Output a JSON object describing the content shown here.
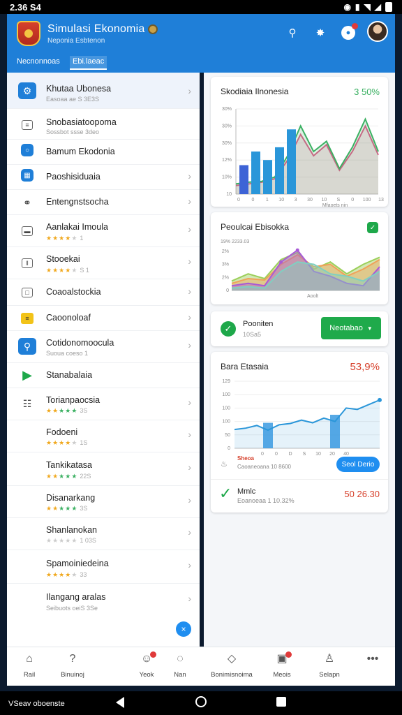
{
  "status_bar": {
    "time": "2.36  S4"
  },
  "app": {
    "title": "Simulasi Ekonomia",
    "subtitle": "Neponia Esbtenon",
    "tabs": [
      {
        "label": "Necnonnoas",
        "active": false
      },
      {
        "label": "Ebi.laeac",
        "active": true
      }
    ]
  },
  "list": [
    {
      "label": "Khutaa Ubonesa",
      "sub": "Easoaa ae S 3E3S",
      "icon": "settings-icon",
      "selected": true,
      "chevron": true
    },
    {
      "label": "Snobasiatoopoma",
      "sub": "Sossbot ssse 3deo",
      "icon": "document-icon",
      "chevron": false
    },
    {
      "label": "Bamum Ekodonia",
      "icon": "info-icon",
      "chevron": false
    },
    {
      "label": "Paoshisiduaia",
      "icon": "calendar-icon",
      "chevron": true
    },
    {
      "label": "Entengnstsocha",
      "icon": "link-icon",
      "chevron": true
    },
    {
      "label": "Aanlakai Imoula",
      "rating": 4,
      "rating_text": "1",
      "icon": "card-icon",
      "chevron": true
    },
    {
      "label": "Stooekai",
      "rating": 4,
      "rating_text": "S 1",
      "icon": "book-icon",
      "chevron": true
    },
    {
      "label": "Coaoalstockia",
      "icon": "book-icon",
      "chevron": true
    },
    {
      "label": "Caoonoloaf",
      "icon": "folder-icon",
      "chevron": true
    },
    {
      "label": "Cotidonomoocula",
      "sub": "Suoua coeso 1",
      "icon": "search-icon",
      "chevron": true
    },
    {
      "label": "Stanabalaia",
      "icon": "play-icon",
      "chevron": false
    },
    {
      "label": "Torianpaocsia",
      "rating": 5,
      "rating_text": "3S",
      "icon": "grid-icon",
      "chevron": true
    },
    {
      "label": "Fodoeni",
      "rating": 4,
      "rating_text": "1S",
      "chevron": true
    },
    {
      "label": "Tankikatasa",
      "rating": 5,
      "rating_text": "22S",
      "chevron": true
    },
    {
      "label": "Disanarkang",
      "rating": 5,
      "rating_text": "3S",
      "chevron": true
    },
    {
      "label": "Shanlanokan",
      "rating": 0,
      "rating_text": "1 03S",
      "chevron": true
    },
    {
      "label": "Spamoiniedeina",
      "rating": 4,
      "rating_text": "33",
      "chevron": true
    },
    {
      "label": "Ilangang aralas",
      "sub": "Seibuots oeiS 3Se",
      "chevron": true
    }
  ],
  "cards": {
    "card1": {
      "title": "Skodiaia Ilnonesia",
      "value": "3 50%",
      "value_color": "#3bb062",
      "chart_data": {
        "type": "bar",
        "x": [
          1,
          2,
          3,
          4,
          5,
          6,
          7,
          8,
          9,
          10,
          11,
          12
        ],
        "bars": [
          {
            "x": 1,
            "value": 34,
            "color": "#3d63d6"
          },
          {
            "x": 2,
            "value": 50,
            "color": "#2a96d9"
          },
          {
            "x": 3,
            "value": 40,
            "color": "#2a96d9"
          },
          {
            "x": 4,
            "value": 55,
            "color": "#2a96d9"
          },
          {
            "x": 5,
            "value": 76,
            "color": "#2a96d9"
          }
        ],
        "series": [
          {
            "values": [
              12,
              14,
              15,
              20,
              45,
              80,
              50,
              62,
              30,
              55,
              88,
              50
            ],
            "color": "#3bb062"
          },
          {
            "values": [
              10,
              12,
              14,
              18,
              40,
              70,
              45,
              58,
              28,
              50,
              80,
              46
            ],
            "color": "#e35a8a"
          }
        ],
        "yticks": [
          "30%",
          "30%",
          "30%",
          "12%",
          "10%",
          "10"
        ],
        "xticks": [
          "0",
          "0",
          "1",
          "10",
          "3",
          "30",
          "10",
          "S",
          "0",
          "100",
          "13"
        ],
        "xlabel": "Mfaoets nin",
        "ylim": [
          0,
          100
        ]
      }
    },
    "card2": {
      "title": "Peoulcai Ebisokka",
      "subtitle": "19%  2233.03",
      "chart_data": {
        "type": "area",
        "x": [
          0,
          1,
          2,
          3,
          4,
          5,
          6,
          7,
          8,
          9
        ],
        "series": [
          {
            "values": [
              20,
              35,
              25,
              65,
              80,
              45,
              60,
              35,
              55,
              70
            ],
            "color": "#9ccf5a"
          },
          {
            "values": [
              15,
              25,
              22,
              55,
              75,
              50,
              55,
              30,
              45,
              65
            ],
            "color": "#f0a15a"
          },
          {
            "values": [
              10,
              15,
              10,
              60,
              85,
              40,
              30,
              15,
              10,
              50
            ],
            "color": "#a85ad6"
          },
          {
            "values": [
              5,
              8,
              5,
              40,
              60,
              55,
              35,
              30,
              20,
              40
            ],
            "color": "#7fd0c2"
          }
        ],
        "yticks": [
          "2%",
          "3%",
          "2%",
          "0"
        ],
        "xlabel": "Aoolt",
        "ylim": [
          0,
          100
        ]
      }
    },
    "card3": {
      "title": "Pooniten",
      "sub": "10Sa5",
      "button": "Neotabao"
    },
    "card4": {
      "title": "Bara Etasaia",
      "value": "53,9%",
      "value_color": "#d6402b",
      "chart_data": {
        "type": "line",
        "x": [
          0,
          1,
          2,
          3,
          4,
          5,
          6,
          7,
          8,
          9,
          10,
          11,
          12,
          13
        ],
        "series": [
          {
            "values": [
              28,
              30,
              34,
              27,
              35,
              37,
              42,
              38,
              45,
              40,
              60,
              58,
              65,
              72
            ],
            "color": "#2a96d9"
          }
        ],
        "bars": [
          {
            "x": 3,
            "value": 38
          },
          {
            "x": 9,
            "value": 50
          }
        ],
        "yticks": [
          "129",
          "100",
          "100",
          "100",
          "50",
          "0"
        ],
        "xticks": [
          "0",
          "0",
          "D",
          "S",
          "10",
          "20",
          "40"
        ],
        "ylim": [
          0,
          100
        ]
      },
      "footer_label": "Sheoa",
      "footer_sub": "Caoaneoana 10 8600",
      "button": "Seol Derio",
      "item_title": "Mmlc",
      "item_sub": "Eoanoeaa 1 10.32%",
      "item_value": "50 26.30"
    }
  },
  "bottom_nav": [
    {
      "label": "Rail",
      "icon": "home-icon",
      "glyph": "⌂"
    },
    {
      "label": "Binuinoj",
      "icon": "help-icon",
      "glyph": "?"
    },
    {
      "label": "Yeok",
      "icon": "people-icon",
      "glyph": "☺",
      "badge": true
    },
    {
      "label": "Nan",
      "icon": "chat-icon",
      "glyph": "◌"
    },
    {
      "label": "Bonimisnoima",
      "icon": "shield-icon",
      "glyph": "◇"
    },
    {
      "label": "Meois",
      "icon": "box-icon",
      "glyph": "▣",
      "badge": true
    },
    {
      "label": "Selapn",
      "icon": "profile-icon",
      "glyph": "♙"
    },
    {
      "label": "",
      "icon": "more-icon",
      "glyph": "•••"
    }
  ],
  "system_nav": {
    "label": "VSeav oboenste"
  }
}
